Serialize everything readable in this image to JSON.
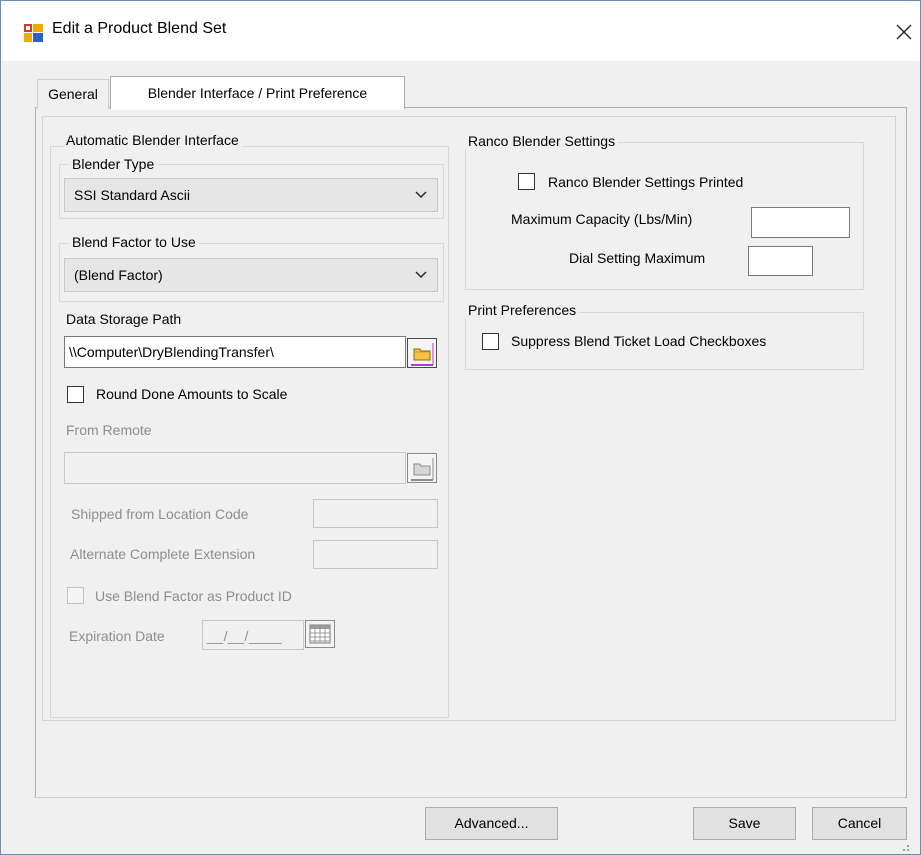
{
  "window": {
    "title": "Edit a Product Blend Set",
    "close_label": "✕"
  },
  "tabs": [
    {
      "label": "General",
      "active": false
    },
    {
      "label": "Blender Interface / Print Preference",
      "active": true
    }
  ],
  "automatic_blender_interface": {
    "title": "Automatic Blender Interface",
    "blender_type": {
      "title": "Blender Type",
      "value": "SSI Standard Ascii"
    },
    "blend_factor": {
      "title": "Blend Factor to Use",
      "value": "(Blend Factor)"
    },
    "data_storage_path": {
      "label": "Data Storage Path",
      "value": "\\\\Computer\\DryBlendingTransfer\\"
    },
    "round_done_amounts": {
      "label": "Round Done Amounts to Scale",
      "checked": false
    },
    "from_remote": {
      "label": "From Remote",
      "value": ""
    },
    "shipped_from_location": {
      "label": "Shipped from Location Code",
      "value": ""
    },
    "alternate_complete_extension": {
      "label": "Alternate Complete Extension",
      "value": ""
    },
    "use_blend_factor": {
      "label": "Use Blend Factor as Product ID",
      "checked": false
    },
    "expiration_date": {
      "label": "Expiration Date",
      "value": "__/__/____"
    }
  },
  "ranco_blender_settings": {
    "title": "Ranco Blender Settings",
    "printed": {
      "label": "Ranco Blender Settings Printed",
      "checked": false
    },
    "max_capacity": {
      "label": "Maximum Capacity (Lbs/Min)",
      "value": ""
    },
    "dial_setting_max": {
      "label": "Dial Setting Maximum",
      "value": ""
    }
  },
  "print_preferences": {
    "title": "Print Preferences",
    "suppress_checkboxes": {
      "label": "Suppress Blend Ticket Load Checkboxes",
      "checked": false
    }
  },
  "buttons": {
    "advanced": "Advanced...",
    "save": "Save",
    "cancel": "Cancel"
  },
  "icons": {
    "app": "product-blend-icon",
    "folder": "folder-browse-icon",
    "calendar": "calendar-icon",
    "dropdown": "chevron-down-icon",
    "close": "close-icon"
  }
}
